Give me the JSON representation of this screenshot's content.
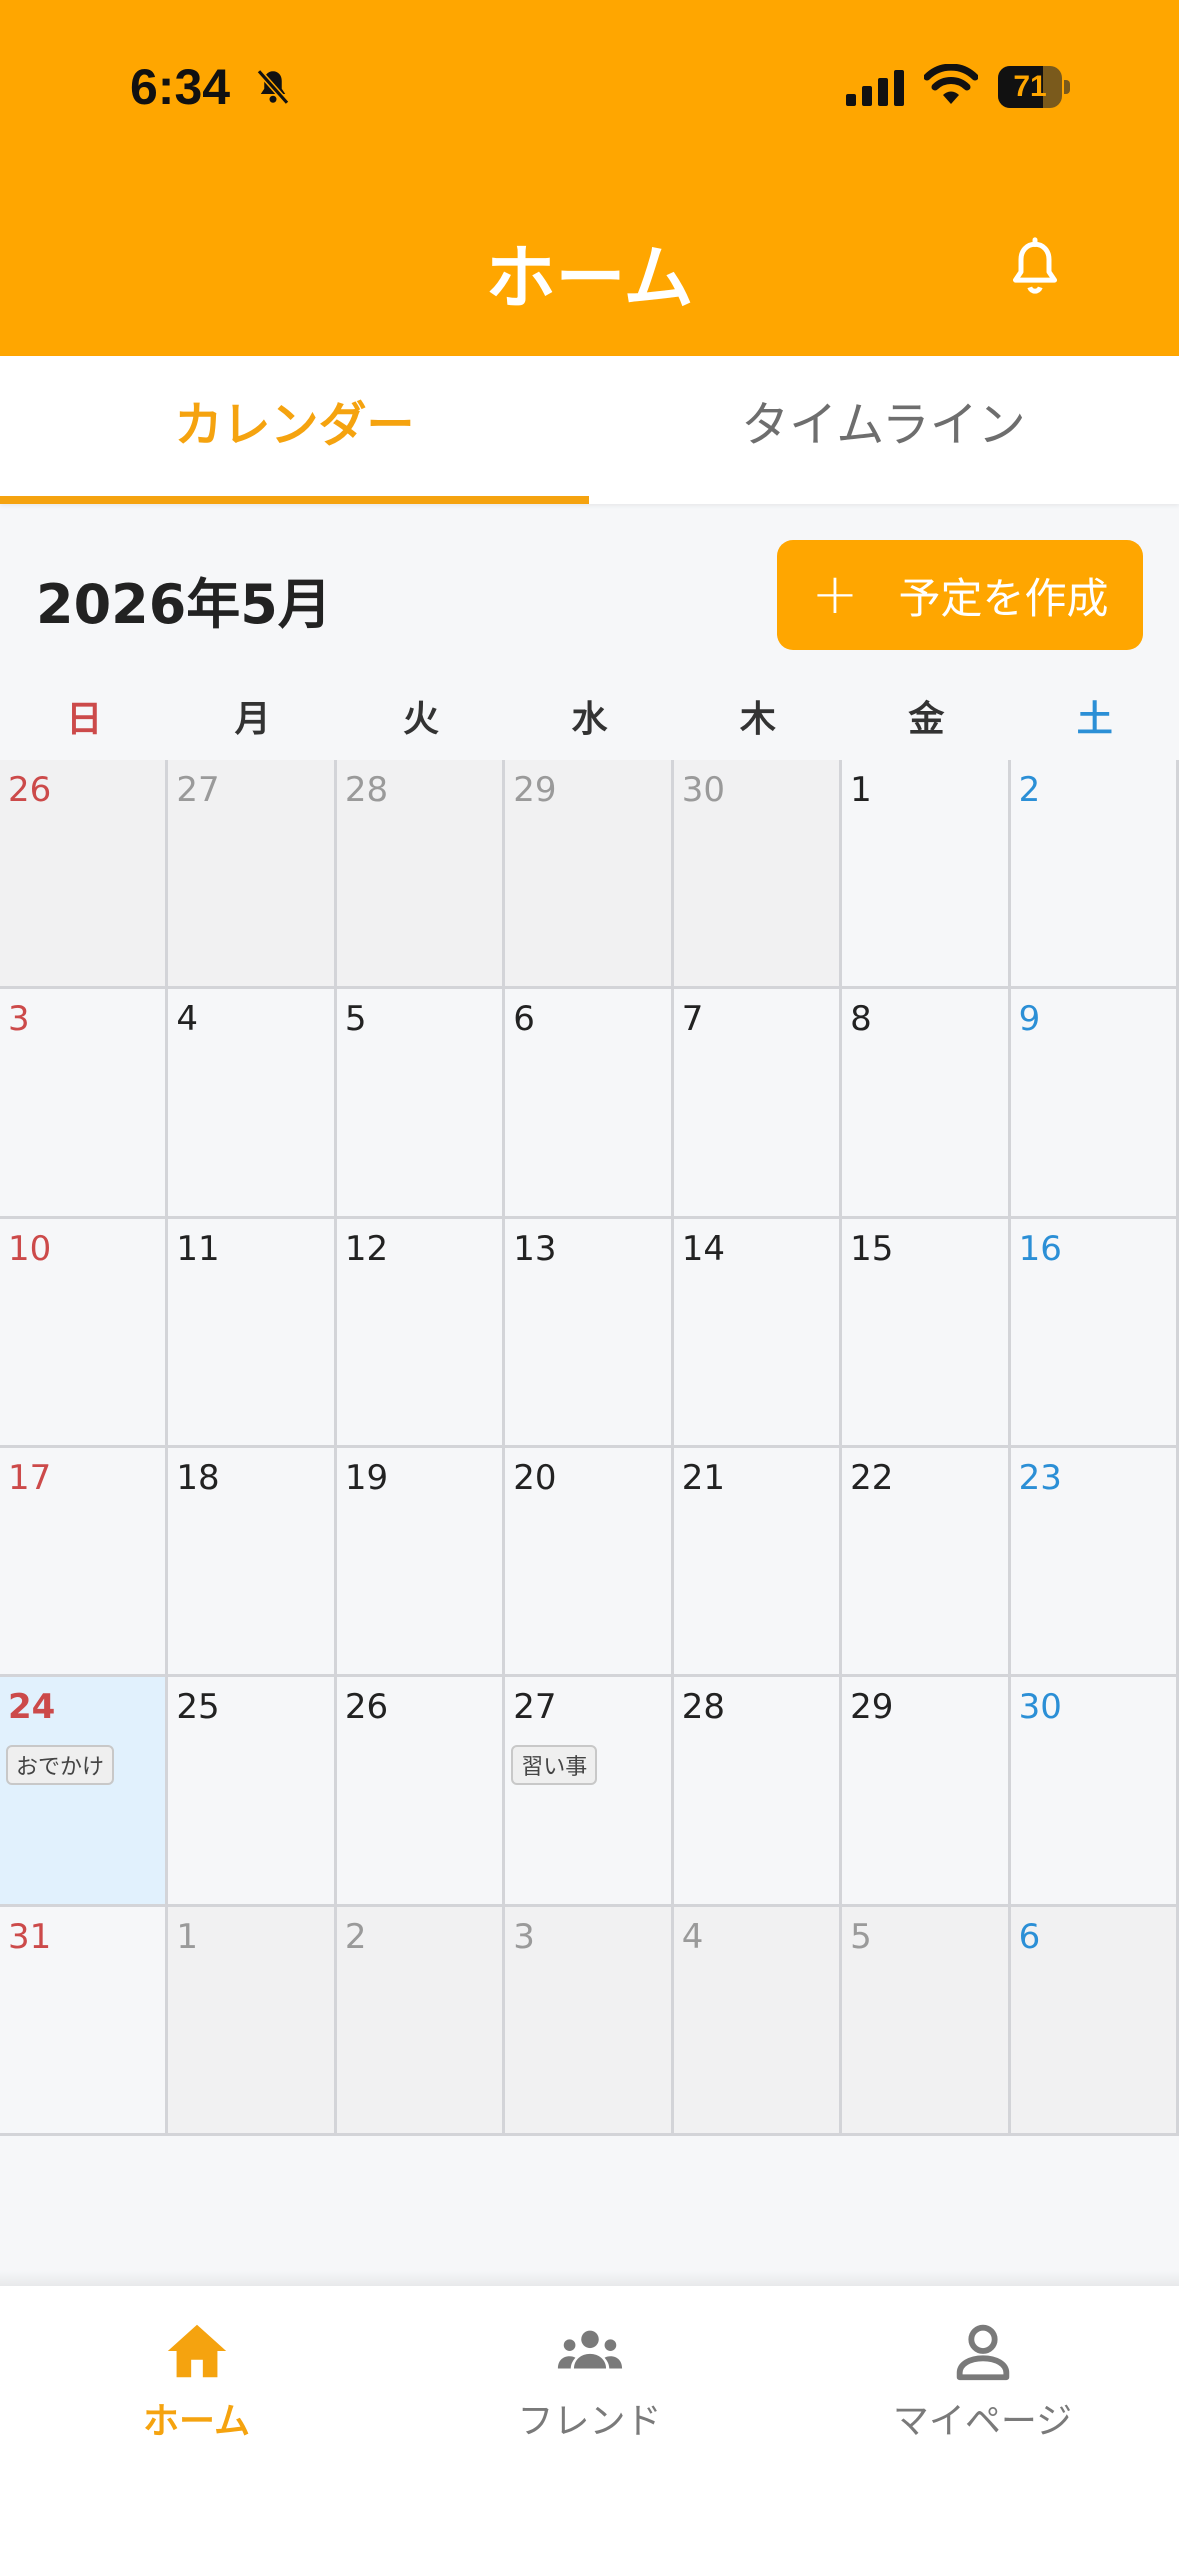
{
  "status_bar": {
    "time": "6:34",
    "battery": "71",
    "battery_level": 0.71
  },
  "header": {
    "title": "ホーム"
  },
  "tabs": [
    {
      "label": "カレンダー",
      "active": true
    },
    {
      "label": "タイムライン",
      "active": false
    }
  ],
  "calendar": {
    "month_title": "2026年5月",
    "create_label": "予定を作成",
    "create_plus": "+",
    "weekdays": [
      "日",
      "月",
      "火",
      "水",
      "木",
      "金",
      "土"
    ],
    "weeks": [
      [
        {
          "day": "26",
          "other": true
        },
        {
          "day": "27",
          "other": true
        },
        {
          "day": "28",
          "other": true
        },
        {
          "day": "29",
          "other": true
        },
        {
          "day": "30",
          "other": true
        },
        {
          "day": "1"
        },
        {
          "day": "2"
        }
      ],
      [
        {
          "day": "3"
        },
        {
          "day": "4"
        },
        {
          "day": "5"
        },
        {
          "day": "6"
        },
        {
          "day": "7"
        },
        {
          "day": "8"
        },
        {
          "day": "9"
        }
      ],
      [
        {
          "day": "10"
        },
        {
          "day": "11"
        },
        {
          "day": "12"
        },
        {
          "day": "13"
        },
        {
          "day": "14"
        },
        {
          "day": "15"
        },
        {
          "day": "16"
        }
      ],
      [
        {
          "day": "17"
        },
        {
          "day": "18"
        },
        {
          "day": "19"
        },
        {
          "day": "20"
        },
        {
          "day": "21"
        },
        {
          "day": "22"
        },
        {
          "day": "23"
        }
      ],
      [
        {
          "day": "24",
          "today": true,
          "event": "おでかけ"
        },
        {
          "day": "25"
        },
        {
          "day": "26"
        },
        {
          "day": "27",
          "event": "習い事"
        },
        {
          "day": "28"
        },
        {
          "day": "29"
        },
        {
          "day": "30"
        }
      ],
      [
        {
          "day": "31"
        },
        {
          "day": "1",
          "other": true
        },
        {
          "day": "2",
          "other": true
        },
        {
          "day": "3",
          "other": true
        },
        {
          "day": "4",
          "other": true
        },
        {
          "day": "5",
          "other": true
        },
        {
          "day": "6",
          "other": true
        }
      ]
    ]
  },
  "bottom_nav": {
    "home": "ホーム",
    "friend": "フレンド",
    "mypage": "マイページ"
  },
  "colors": {
    "accent": "#ffa600",
    "sunday": "#cc4a4a",
    "saturday": "#2b8fd6",
    "today_bg": "#e1f1fd"
  },
  "icons": {
    "bell_off": "bell-slash-icon",
    "notify": "bell-icon",
    "home": "home-icon",
    "friend": "group-icon",
    "mypage": "person-icon"
  }
}
